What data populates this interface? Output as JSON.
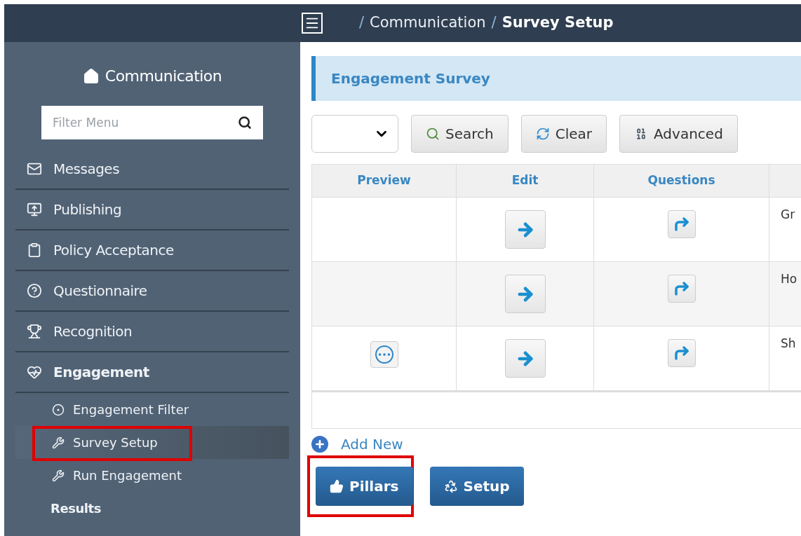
{
  "top_bar": {
    "breadcrumb": [
      {
        "separator": "/",
        "label": "Communication",
        "current": false
      },
      {
        "separator": "/",
        "label": "Survey Setup",
        "current": true
      }
    ]
  },
  "sidebar": {
    "title": "Communication",
    "filter": {
      "placeholder": "Filter Menu"
    },
    "items": [
      {
        "label": "Messages",
        "expanded": false
      },
      {
        "label": "Publishing",
        "expanded": false
      },
      {
        "label": "Policy Acceptance",
        "expanded": false
      },
      {
        "label": "Questionnaire",
        "expanded": false
      },
      {
        "label": "Recognition",
        "expanded": false
      },
      {
        "label": "Engagement",
        "expanded": true,
        "children": [
          {
            "label": "Engagement Filter",
            "kind": "target",
            "selected": false,
            "highlighted": false
          },
          {
            "label": "Survey Setup",
            "kind": "tools",
            "selected": true,
            "highlighted": true
          },
          {
            "label": "Run Engagement",
            "kind": "tools",
            "selected": false,
            "highlighted": false
          },
          {
            "label": "Results",
            "kind": "heading",
            "selected": false,
            "highlighted": false
          }
        ]
      }
    ]
  },
  "panel": {
    "title": "Engagement Survey",
    "toolbar": [
      {
        "label": "Search"
      },
      {
        "label": "Clear"
      },
      {
        "label": "Advanced"
      }
    ],
    "table": {
      "columns": [
        "Preview",
        "Edit",
        "Questions"
      ],
      "rows": [
        {
          "preview": false,
          "column_4": "Gr"
        },
        {
          "preview": false,
          "column_4": "Ho"
        },
        {
          "preview": true,
          "column_4": "Sh"
        }
      ]
    },
    "add_new": "Add New",
    "buttons": [
      {
        "label": "Pillars",
        "highlighted": true
      },
      {
        "label": "Setup",
        "highlighted": false
      }
    ]
  }
}
